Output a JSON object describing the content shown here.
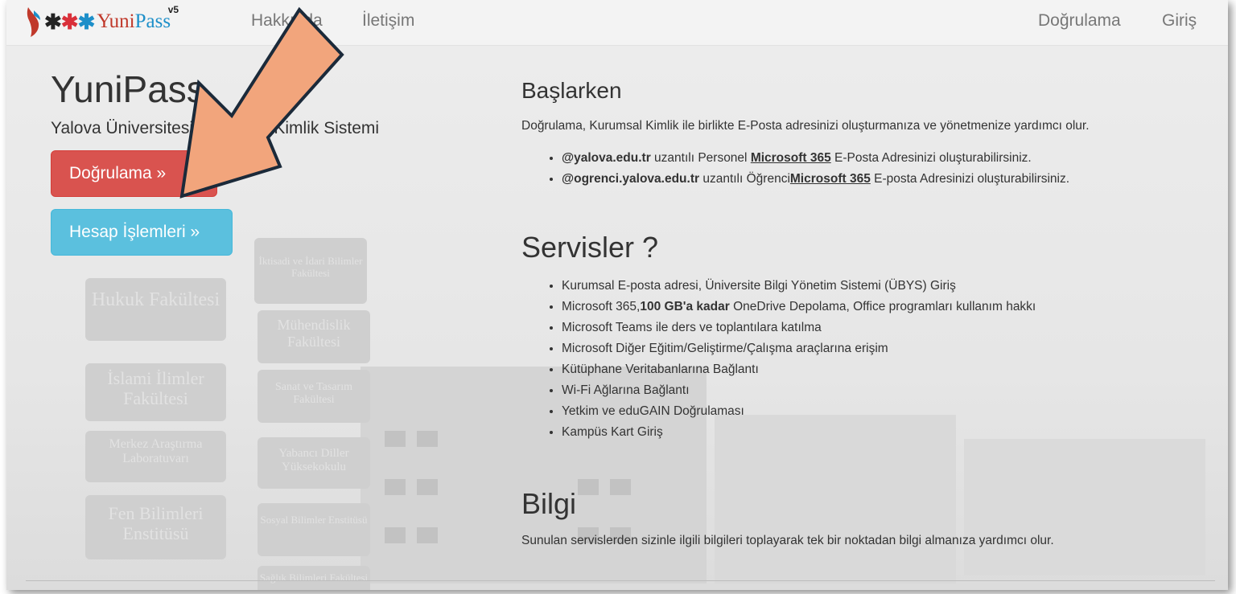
{
  "nav": {
    "brand": "YuniPass",
    "brand_part1": "Yuni",
    "brand_part2": "Pass",
    "brand_stars": [
      "✱",
      "✱",
      "✱"
    ],
    "version": "v5",
    "links_left": [
      "Hakkında",
      "İletişim"
    ],
    "links_right": [
      "Doğrulama",
      "Giriş"
    ]
  },
  "hero": {
    "title": "YuniPass",
    "subtitle": "Yalova Üniversitesi Kurumsal Kimlik Sistemi",
    "btn_verify": "Doğrulama »",
    "btn_account": "Hesap İşlemleri »"
  },
  "start": {
    "heading": "Başlarken",
    "intro": "Doğrulama, Kurumsal Kimlik ile birlikte E-Posta adresinizi oluşturmanıza ve yönetmenize yardımcı olur.",
    "items": [
      {
        "domain": "@yalova.edu.tr",
        "mid": " uzantılı Personel ",
        "link": "Microsoft 365",
        "end": " E-Posta Adresinizi oluşturabilirsiniz."
      },
      {
        "domain": "@ogrenci.yalova.edu.tr",
        "mid": " uzantılı Öğrenci",
        "link": "Microsoft 365",
        "end": " E-posta Adresinizi oluşturabilirsiniz."
      }
    ]
  },
  "services": {
    "heading": "Servisler ?",
    "items": [
      "Kurumsal E-posta adresi, Üniversite Bilgi Yönetim Sistemi (ÜBYS) Giriş",
      {
        "pre": "Microsoft 365,",
        "bold": "100 GB'a kadar",
        "post": " OneDrive Depolama, Office programları kullanım hakkı"
      },
      "Microsoft Teams ile ders ve toplantılara katılma",
      "Microsoft Diğer Eğitim/Geliştirme/Çalışma araçlarına erişim",
      "Kütüphane Veritabanlarına Bağlantı",
      "Wi-Fi Ağlarına Bağlantı",
      "Yetkim ve eduGAIN Doğrulaması",
      "Kampüs Kart Giriş"
    ]
  },
  "info": {
    "heading": "Bilgi",
    "text": "Sunulan servislerden sizinle ilgili bilgileri toplayarak tek bir noktadan bilgi almanıza yardımcı olur."
  },
  "background_signs": [
    "Hukuk Fakültesi",
    "İslami İlimler Fakültesi",
    "Merkez Araştırma Laboratuvarı",
    "Fen Bilimleri Enstitüsü",
    "İktisadi ve İdari Bilimler Fakültesi",
    "Mühendislik Fakültesi",
    "Sanat ve Tasarım Fakültesi",
    "Yabancı Diller Yüksekokulu",
    "Sosyal Bilimler Enstitüsü",
    "Sağlık Bilimleri Fakültesi"
  ],
  "colors": {
    "danger": "#d9534f",
    "info": "#5bc0de",
    "arrow_fill": "#f2a57c",
    "arrow_stroke": "#1b2a3a",
    "brand_red": "#c0392b",
    "brand_blue": "#1d8fc9"
  }
}
